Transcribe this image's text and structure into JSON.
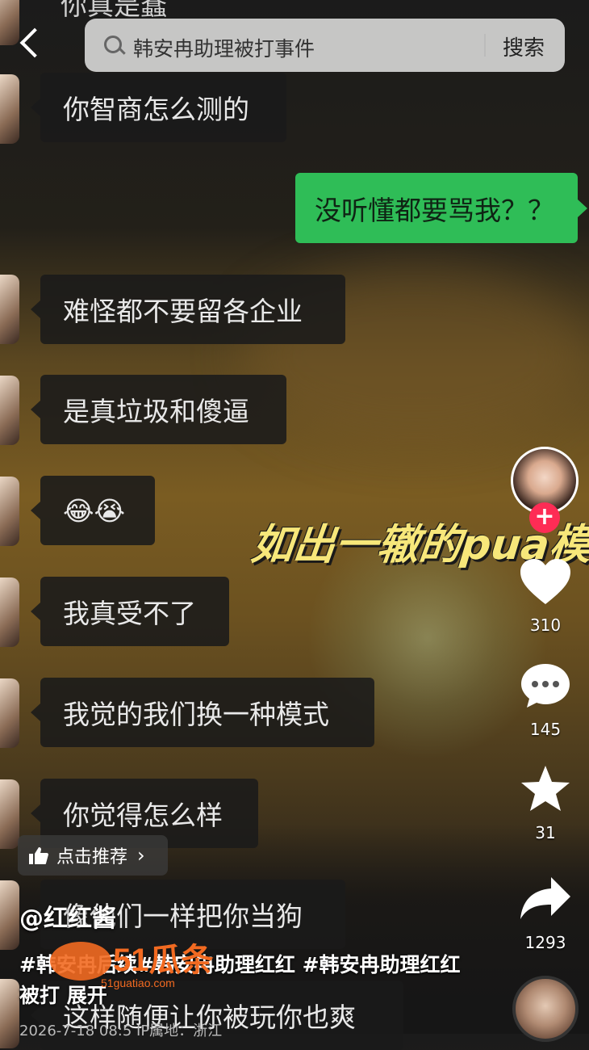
{
  "search": {
    "query": "韩安冉助理被打事件",
    "button_label": "搜索"
  },
  "chat": {
    "top_cut_text": "你真是蠢",
    "messages": [
      {
        "text": "你智商怎么测的",
        "side": "left"
      },
      {
        "text": "没听懂都要骂我？？",
        "side": "right"
      },
      {
        "text": "难怪都不要留各企业",
        "side": "left"
      },
      {
        "text": "是真垃圾和傻逼",
        "side": "left"
      },
      {
        "text": "😂😭",
        "side": "left"
      },
      {
        "text": "我真受不了",
        "side": "left"
      },
      {
        "text": "我觉的我们换一种模式",
        "side": "left"
      },
      {
        "text": "你觉得怎么样",
        "side": "left"
      },
      {
        "text": "像他们一样把你当狗",
        "side": "left"
      },
      {
        "text": "这样随便让你被玩你也爽",
        "side": "left"
      }
    ]
  },
  "overlay_caption": "如出一辙的pua模式",
  "actions": {
    "likes": "310",
    "comments": "145",
    "favorites": "31",
    "shares": "1293"
  },
  "recommend_label": "点击推荐",
  "author": "@红红酱",
  "description": "#韩安冉后续#韩安冉助理红红 #韩安冉助理红红被打 展开",
  "date_text": "2026-7-18 08:5 IP属地：浙江",
  "watermark": {
    "brand": "51瓜条",
    "url": "51guatiao.com"
  },
  "colors": {
    "green_bubble": "#2fbd57",
    "follow": "#fe2c55",
    "overlay": "#f7e77a"
  }
}
